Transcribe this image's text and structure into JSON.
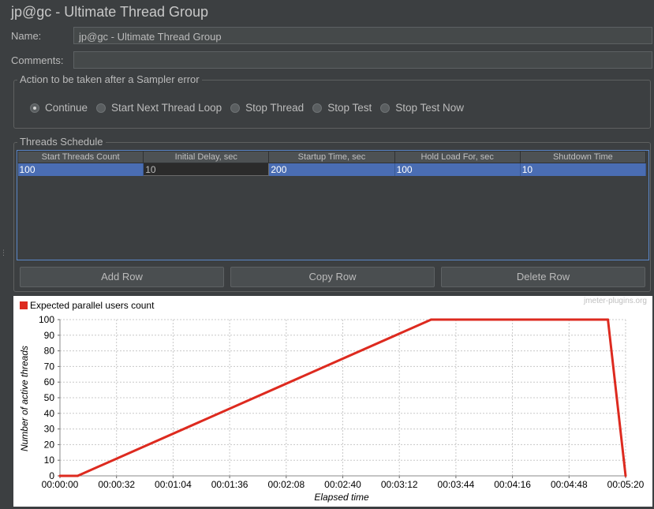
{
  "window": {
    "title": "jp@gc - Ultimate Thread Group"
  },
  "name": {
    "label": "Name:",
    "value": "jp@gc - Ultimate Thread Group"
  },
  "comments": {
    "label": "Comments:",
    "value": ""
  },
  "sampler_error": {
    "legend": "Action to be taken after a Sampler error",
    "options": [
      "Continue",
      "Start Next Thread Loop",
      "Stop Thread",
      "Stop Test",
      "Stop Test Now"
    ],
    "selected": "Continue"
  },
  "schedule": {
    "legend": "Threads Schedule",
    "columns": [
      "Start Threads Count",
      "Initial Delay, sec",
      "Startup Time, sec",
      "Hold Load For, sec",
      "Shutdown Time"
    ],
    "rows": [
      [
        "100",
        "10",
        "200",
        "100",
        "10"
      ]
    ]
  },
  "buttons": {
    "add_row": "Add Row",
    "copy_row": "Copy Row",
    "delete_row": "Delete Row"
  },
  "colors": {
    "series": "#dd2a1f",
    "selected_row": "#4a6db3",
    "background": "#3c3f41"
  },
  "chart_data": {
    "type": "line",
    "watermark": "jmeter-plugins.org",
    "xlabel": "Elapsed time",
    "ylabel": "Number of active threads",
    "xlim": [
      0,
      320
    ],
    "ylim": [
      0,
      100
    ],
    "x_ticks": [
      "00:00:00",
      "00:00:32",
      "00:01:04",
      "00:01:36",
      "00:02:08",
      "00:02:40",
      "00:03:12",
      "00:03:44",
      "00:04:16",
      "00:04:48",
      "00:05:20"
    ],
    "y_ticks": [
      "0",
      "10",
      "20",
      "30",
      "40",
      "50",
      "60",
      "70",
      "80",
      "90",
      "100"
    ],
    "grid": true,
    "legend_position": "top-left",
    "series": [
      {
        "name": "Expected parallel users count",
        "x": [
          0,
          10,
          210,
          310,
          320
        ],
        "y": [
          0,
          0,
          100,
          100,
          0
        ]
      }
    ]
  }
}
